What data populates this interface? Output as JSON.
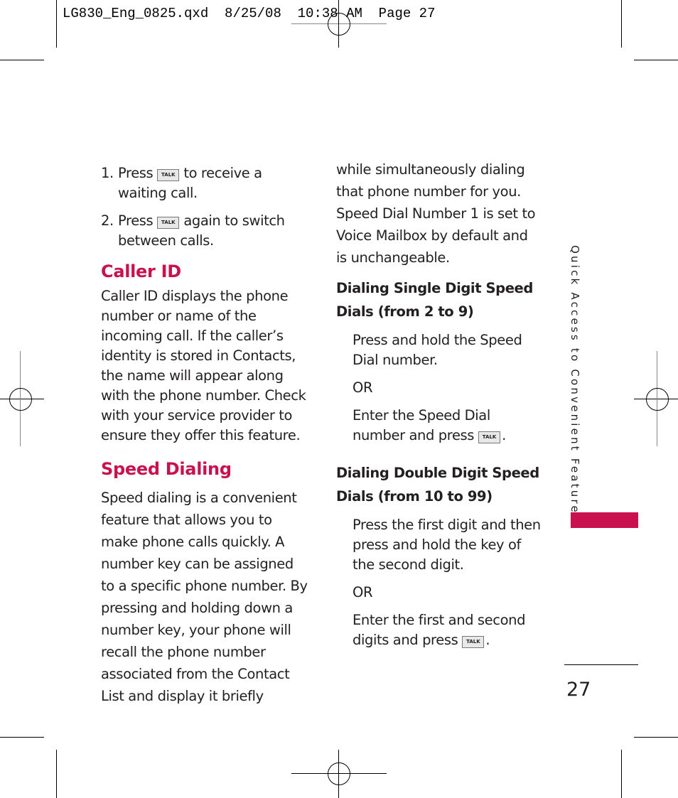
{
  "slug": "LG830_Eng_0825.qxd  8/25/08  10:38 AM  Page 27",
  "colors": {
    "accent": "#c8114e",
    "text": "#231f20"
  },
  "talk_key": {
    "icon": "talk-key-icon",
    "label": "TALK"
  },
  "left_column": {
    "steps": [
      {
        "number": "1.",
        "before": "Press",
        "after": "to receive a waiting call."
      },
      {
        "number": "2.",
        "before": "Press",
        "after": "again to switch between calls."
      }
    ],
    "caller_id": {
      "heading": "Caller ID",
      "body": "Caller ID displays the phone number or name of the incoming call. If the caller’s identity is stored in Contacts, the name will appear along with the phone number. Check with your service provider to ensure they offer this feature."
    },
    "speed_dialing": {
      "heading": "Speed Dialing",
      "body": "Speed dialing is a convenient feature that allows you to make phone calls quickly. A number key can be assigned to a specific phone number. By pressing and holding down a number key, your phone will recall the phone number associated from the Contact List and display it briefly"
    }
  },
  "right_column": {
    "continuation": "while simultaneously dialing that phone number for you. Speed Dial Number 1 is set to Voice Mailbox by default and is unchangeable.",
    "single": {
      "heading": "Dialing Single Digit Speed Dials (from 2 to 9)",
      "step1": "Press and hold the Speed Dial number.",
      "or": "OR",
      "step2": "Enter the Speed Dial number and press",
      "end": "."
    },
    "double": {
      "heading": "Dialing Double Digit Speed Dials (from 10 to 99)",
      "step1": "Press the first digit and then press and hold the key of the second digit.",
      "or": "OR",
      "step2": "Enter the first and second digits and press",
      "end": "."
    }
  },
  "side_tab": {
    "label": "Quick Access to Convenient Features"
  },
  "page_number": "27"
}
